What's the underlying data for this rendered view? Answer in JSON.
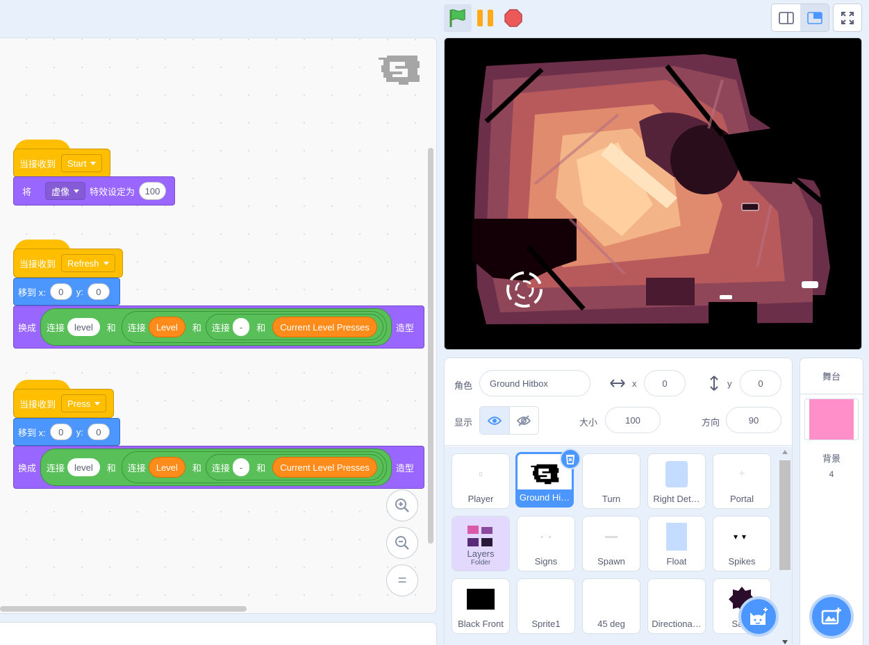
{
  "blocks": {
    "stack1": {
      "hat_label": "当接收到",
      "message": "Start",
      "set_prefix": "将",
      "effect": "虚像",
      "set_mid": "特效设定为",
      "value": "100"
    },
    "stack2": {
      "hat_label": "当接收到",
      "message": "Refresh",
      "goto": "移到 x:",
      "x": "0",
      "y_label": "y:",
      "y": "0",
      "switch_label": "换成",
      "join": "连接",
      "and": "和",
      "level_text": "level",
      "level_var": "Level",
      "dash": "-",
      "presses_var": "Current Level Presses",
      "costume": "造型"
    },
    "stack3": {
      "hat_label": "当接收到",
      "message": "Press",
      "goto": "移到 x:",
      "x": "0",
      "y_label": "y:",
      "y": "0",
      "switch_label": "换成",
      "join": "连接",
      "and": "和",
      "level_text": "level",
      "level_var": "Level",
      "dash": "-",
      "presses_var": "Current Level Presses",
      "costume": "造型"
    }
  },
  "zoom": {
    "in": "+",
    "out": "−",
    "reset": "="
  },
  "sprite_info": {
    "sprite_label": "角色",
    "sprite_name": "Ground Hitbox",
    "x_label": "x",
    "x": "0",
    "y_label": "y",
    "y": "0",
    "show_label": "显示",
    "size_label": "大小",
    "size": "100",
    "direction_label": "方向",
    "direction": "90"
  },
  "sprites": [
    {
      "name": "Player"
    },
    {
      "name": "Ground Hi…",
      "selected": true
    },
    {
      "name": "Turn"
    },
    {
      "name": "Right Det…"
    },
    {
      "name": "Portal"
    },
    {
      "name": "Layers",
      "sub": "Folder"
    },
    {
      "name": "Signs"
    },
    {
      "name": "Spawn"
    },
    {
      "name": "Float"
    },
    {
      "name": "Spikes"
    },
    {
      "name": "Black Front"
    },
    {
      "name": "Sprite1"
    },
    {
      "name": "45 deg"
    },
    {
      "name": "Directiona…"
    },
    {
      "name": "Sa…"
    }
  ],
  "stage_panel": {
    "title": "舞台",
    "backdrops_label": "背景",
    "backdrops_count": "4",
    "thumb_color": "#ff8fc8"
  },
  "colors": {
    "accent": "#4c97ff",
    "events": "#ffbf00",
    "looks": "#9966ff",
    "motion": "#4c97ff",
    "operators": "#59c059",
    "variables": "#ff8c1a"
  },
  "icons": [
    "green-flag-icon",
    "pause-icon",
    "stop-icon",
    "small-stage-icon",
    "normal-stage-icon",
    "fullscreen-icon",
    "eye-icon",
    "eye-slash-icon",
    "arrows-horizontal-icon",
    "arrows-vertical-icon",
    "trash-icon",
    "add-sprite-cat-icon",
    "add-backdrop-icon",
    "zoom-in-icon",
    "zoom-out-icon",
    "zoom-reset-icon"
  ]
}
